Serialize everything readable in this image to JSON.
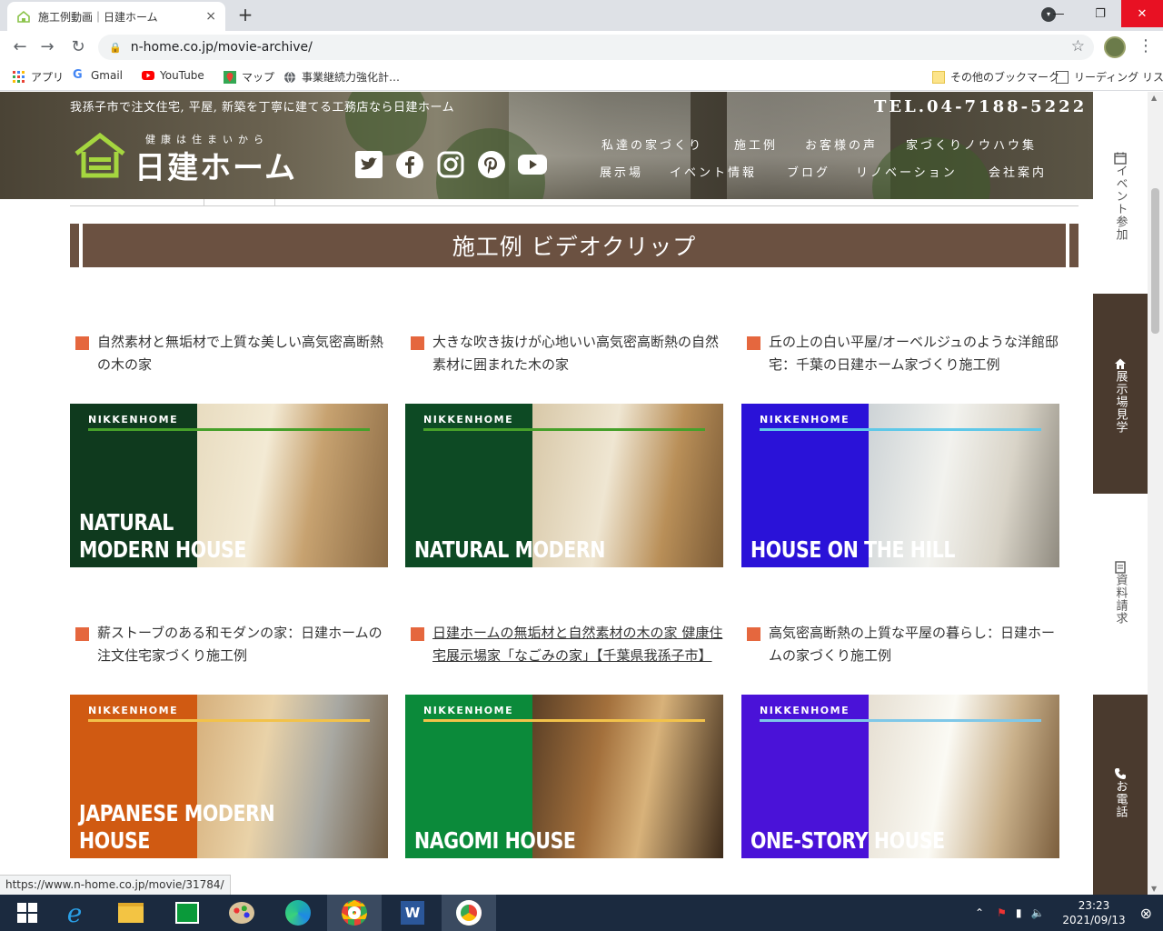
{
  "browser": {
    "tab_title": "施工例動画｜日建ホーム",
    "tab_close": "×",
    "new_tab": "+",
    "url": "n-home.co.jp/movie-archive/",
    "status_url": "https://www.n-home.co.jp/movie/31784/",
    "window_controls": {
      "minimize": "—",
      "maximize": "❐",
      "close": "✕"
    },
    "bookmarks": [
      {
        "label": "アプリ",
        "icon": "apps-grid-icon"
      },
      {
        "label": "Gmail",
        "icon": "google-icon"
      },
      {
        "label": "YouTube",
        "icon": "youtube-icon"
      },
      {
        "label": "マップ",
        "icon": "maps-icon"
      },
      {
        "label": "事業継続力強化計…",
        "icon": "globe-icon"
      }
    ],
    "other_bookmarks": "その他のブックマーク",
    "reading_list": "リーディング リスト"
  },
  "header": {
    "tagline": "我孫子市で注文住宅, 平屋, 新築を丁寧に建てる工務店なら日建ホーム",
    "tel": "TEL.04-7188-5222",
    "logo_sub": "健康は住まいから",
    "logo_main": "日建ホーム",
    "nav_row1": [
      "私達の家づくり",
      "施工例",
      "お客様の声",
      "家づくりノウハウ集"
    ],
    "nav_row2": [
      "展示場",
      "イベント情報",
      "ブログ",
      "リノベーション",
      "会社案内"
    ],
    "social": [
      "twitter-icon",
      "facebook-icon",
      "instagram-icon",
      "pinterest-icon",
      "youtube-icon"
    ]
  },
  "section_title": "施工例 ビデオクリップ",
  "cards": [
    {
      "caption": "自然素材と無垢材で上質な美しい高気密高断熱の木の家",
      "brand": "NIKKENHOME",
      "title1": "NATURAL",
      "title2": "MODERN HOUSE",
      "panel": "#0f3a1e",
      "rule": "#46a02a",
      "photo": "warm"
    },
    {
      "caption": "大きな吹き抜けが心地いい高気密高断熱の自然素材に囲まれた木の家",
      "brand": "NIKKENHOME",
      "title1": "NATURAL MODERN",
      "title2": "",
      "panel": "#0d4a24",
      "rule": "#46a02a",
      "photo": "living"
    },
    {
      "caption": "丘の上の白い平屋/オーベルジュのような洋館邸宅：千葉の日建ホーム家づくり施工例",
      "brand": "NIKKENHOME",
      "title1": "HOUSE ON THE HILL",
      "title2": "",
      "panel": "#2a12d8",
      "rule": "#5fc8e8",
      "photo": "white"
    },
    {
      "caption": "薪ストーブのある和モダンの家：日建ホームの注文住宅家づくり施工例",
      "brand": "NIKKENHOME",
      "title1": "JAPANESE MODERN",
      "title2": "HOUSE",
      "panel": "#d05a12",
      "rule": "#f2c24a",
      "photo": "kitchen"
    },
    {
      "caption": "日建ホームの無垢材と自然素材の木の家 健康住宅展示場家「なごみの家」【千葉県我孫子市】",
      "brand": "NIKKENHOME",
      "title1": "NAGOMI HOUSE",
      "title2": "",
      "panel": "#0b8a3a",
      "rule": "#f2c24a",
      "photo": "dark",
      "link": true
    },
    {
      "caption": "高気密高断熱の上質な平屋の暮らし：日建ホームの家づくり施工例",
      "brand": "NIKKENHOME",
      "title1": "ONE-STORY HOUSE",
      "title2": "",
      "panel": "#4a12d8",
      "rule": "#7fc8e8",
      "photo": "dining"
    }
  ],
  "sidebar": {
    "event": "イベント参加",
    "showroom": "展示場見学",
    "docs": "資料請求",
    "phone": "お電話"
  },
  "taskbar": {
    "time": "23:23",
    "date": "2021/09/13"
  },
  "colors": {
    "title_band": "#6b5141",
    "side_tab": "#4a3a2e",
    "bullet": "#e5673e"
  }
}
